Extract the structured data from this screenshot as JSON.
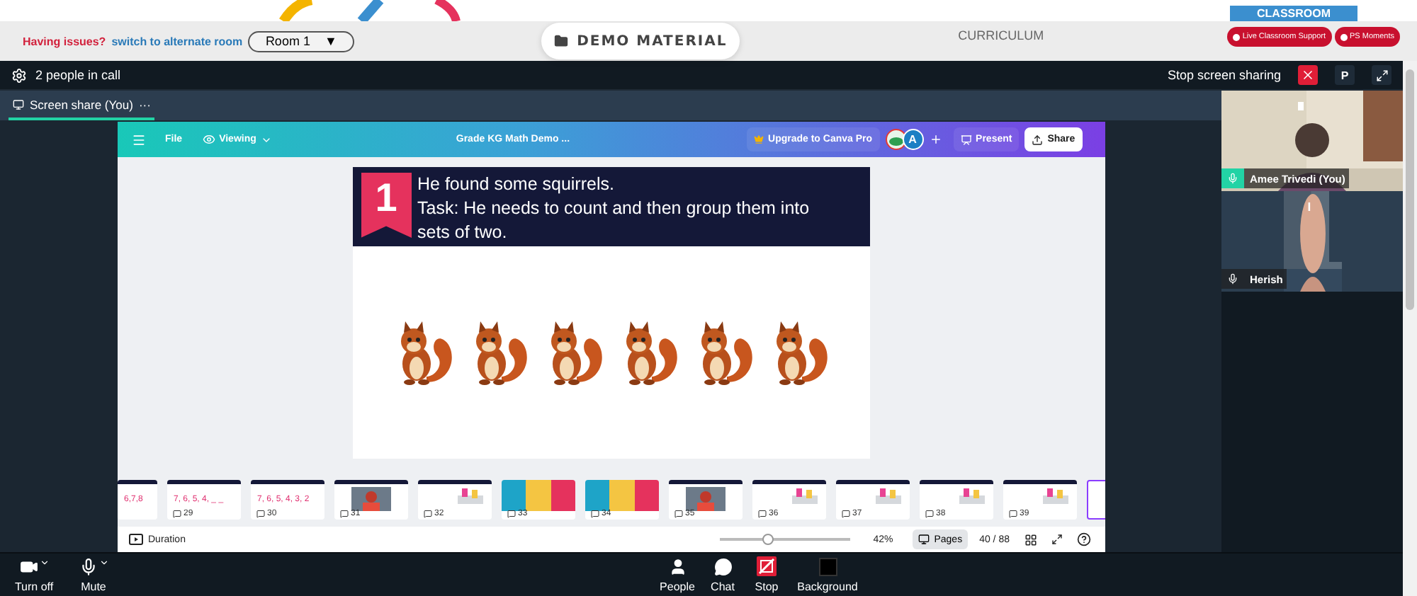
{
  "top_bar": {
    "issue_prompt": "Having issues?",
    "switch_link": "switch to alternate room",
    "room_select": "Room 1",
    "room_caret": "▼",
    "demo_button": "DEMO MATERIAL",
    "curriculum": "CURRICULUM",
    "classroom_tab": "CLASSROOM",
    "support_buttons": [
      "Live Classroom Support",
      "PS Moments"
    ]
  },
  "call_header": {
    "title": "2 people in call",
    "stop_sharing": "Stop screen sharing",
    "participant_initial": "P"
  },
  "tabs": [
    {
      "label": "Screen share (You)",
      "more": "···",
      "selected": true
    }
  ],
  "canva": {
    "file_menu": "File",
    "view_mode": "Viewing",
    "doc_title": "Grade KG Math Demo ...",
    "upgrade": "Upgrade to Canva Pro",
    "avatar": "A",
    "present": "Present",
    "share": "Share",
    "slide": {
      "badge": "1",
      "lines": [
        "He found some squirrels.",
        "Task: He needs to count and then group them into sets of two."
      ]
    },
    "thumbnails": [
      {
        "kind": "text",
        "preview": "6,7,8",
        "selected": false
      },
      {
        "kind": "text",
        "number": "29",
        "preview": "7, 6, 5, 4, _ _",
        "selected": false
      },
      {
        "kind": "text",
        "number": "30",
        "preview": "7, 6, 5, 4, 3, 2",
        "selected": false
      },
      {
        "kind": "picture",
        "number": "31",
        "selected": false
      },
      {
        "kind": "diagram",
        "number": "32",
        "selected": false
      },
      {
        "kind": "tiles",
        "number": "33",
        "selected": false
      },
      {
        "kind": "tiles",
        "number": "34",
        "selected": false
      },
      {
        "kind": "picture",
        "number": "35",
        "selected": false
      },
      {
        "kind": "diagram",
        "number": "36",
        "selected": false
      },
      {
        "kind": "diagram",
        "number": "37",
        "selected": false
      },
      {
        "kind": "diagram",
        "number": "38",
        "selected": false
      },
      {
        "kind": "diagram",
        "number": "39",
        "selected": false
      },
      {
        "kind": "blank",
        "selected": true
      }
    ],
    "footer": {
      "duration": "Duration",
      "zoom": {
        "level": 0.37
      },
      "zoom_reading": "42%",
      "pages": "Pages",
      "page_count": "40 / 88"
    }
  },
  "participants": [
    {
      "name": "Amee Trivedi (You)",
      "highlighted": true
    },
    {
      "name": "Herish",
      "highlighted": false
    }
  ],
  "controls": [
    {
      "kind": "camera",
      "label": "Turn off",
      "dropdown": true
    },
    {
      "kind": "mic",
      "label": "Mute",
      "dropdown": true
    },
    {
      "kind": "people",
      "label": "People",
      "dropdown": false
    },
    {
      "kind": "chat",
      "label": "Chat",
      "dropdown": false
    },
    {
      "kind": "stop",
      "label": "Stop",
      "dropdown": false
    },
    {
      "kind": "background",
      "label": "Background",
      "dropdown": false
    }
  ]
}
